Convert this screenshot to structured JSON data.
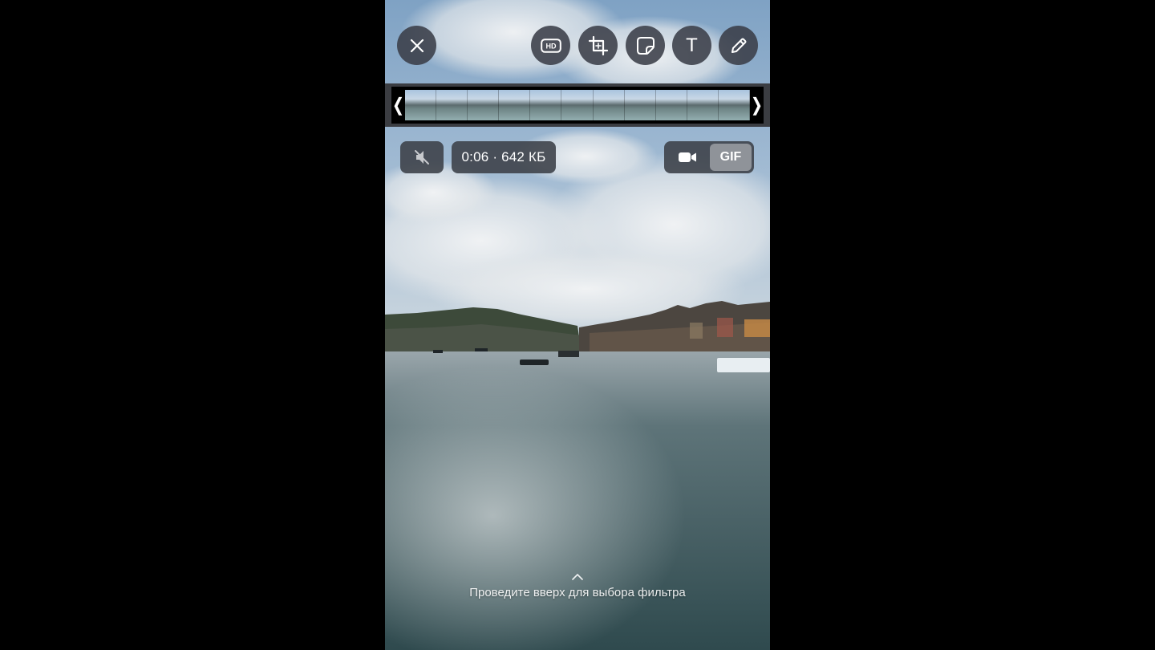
{
  "editor": {
    "toolbar": {
      "close": {
        "icon": "close-icon"
      },
      "hd": {
        "icon": "hd-icon",
        "label": "HD"
      },
      "crop": {
        "icon": "crop-icon"
      },
      "sticker": {
        "icon": "sticker-icon"
      },
      "text": {
        "icon": "text-icon",
        "label": "T"
      },
      "draw": {
        "icon": "pencil-icon"
      }
    },
    "timeline": {
      "frame_count": 11,
      "left_handle": "❬",
      "right_handle": "❭"
    },
    "info": {
      "mute_icon": "speaker-muted-icon",
      "duration_size": "0:06 · 642 КБ"
    },
    "mode": {
      "video_icon": "video-camera-icon",
      "gif_label": "GIF",
      "selected": "GIF"
    },
    "hint": {
      "icon": "chevron-up-icon",
      "text": "Проведите вверх для выбора фильтра"
    },
    "colors": {
      "button_bg": "#3a3e48",
      "gif_selected_bg": "#8f9399",
      "letterbox": "#000000"
    }
  }
}
